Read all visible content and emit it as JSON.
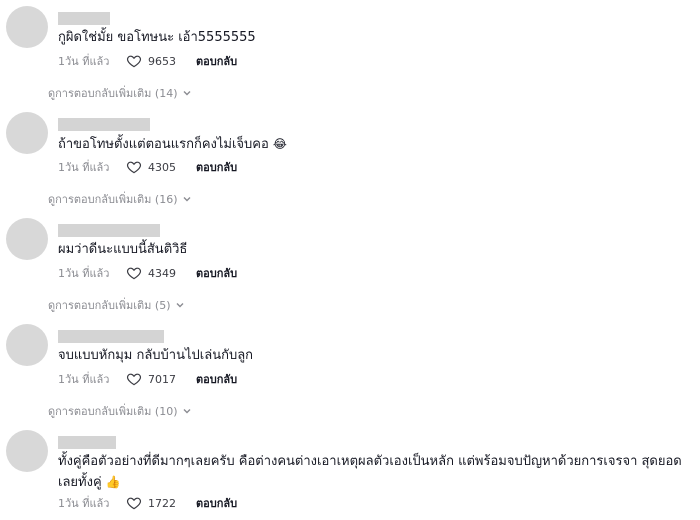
{
  "comments": [
    {
      "text": "กูผิดใช่มั้ย ขอโทษนะ เอ้า5555555",
      "emoji": "",
      "time": "1วัน ที่แล้ว",
      "likes": "9653",
      "reply_label": "ตอบกลับ",
      "view_replies": "ดูการตอบกลับเพิ่มเติม (14)"
    },
    {
      "text": "ถ้าขอโทษตั้งแต่ตอนแรกก็คงไม่เจ็บคอ",
      "emoji": "😂",
      "time": "1วัน ที่แล้ว",
      "likes": "4305",
      "reply_label": "ตอบกลับ",
      "view_replies": "ดูการตอบกลับเพิ่มเติม (16)"
    },
    {
      "text": "ผมว่าดีนะแบบนี้สันติวิธี",
      "emoji": "",
      "time": "1วัน ที่แล้ว",
      "likes": "4349",
      "reply_label": "ตอบกลับ",
      "view_replies": "ดูการตอบกลับเพิ่มเติม (5)"
    },
    {
      "text": "จบแบบหักมุม กลับบ้านไปเล่นกับลูก",
      "emoji": "",
      "time": "1วัน ที่แล้ว",
      "likes": "7017",
      "reply_label": "ตอบกลับ",
      "view_replies": "ดูการตอบกลับเพิ่มเติม (10)"
    },
    {
      "text": "ทั้งคู่คือตัวอย่างที่ดีมากๆเลยครับ คือต่างคนต่างเอาเหตุผลตัวเองเป็นหลัก แต่พร้อมจบปัญหาด้วยการเจรจา สุดยอด เลยทั้งคู่",
      "emoji": "👍",
      "time": "1วัน ที่แล้ว",
      "likes": "1722",
      "reply_label": "ตอบกลับ",
      "view_replies": ""
    }
  ]
}
